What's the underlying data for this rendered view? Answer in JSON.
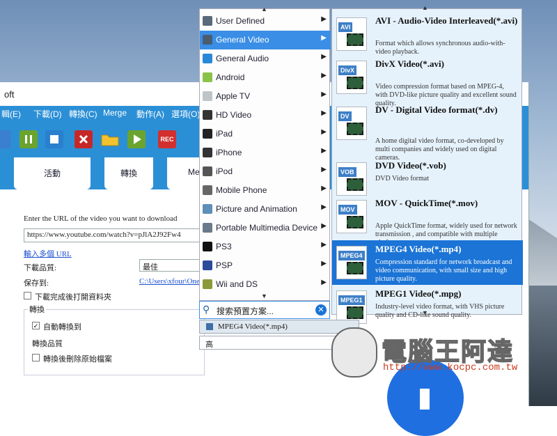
{
  "window": {
    "title_fragment": "oft"
  },
  "menu": [
    "輯(E)",
    "下載(D)",
    "轉換(C)",
    "Merge",
    "動作(A)",
    "選項(O)"
  ],
  "tabs": [
    "活動",
    "轉換",
    "Me"
  ],
  "form": {
    "url_prompt": "Enter the URL of the video you want to download",
    "url_value": "https://www.youtube.com/watch?v=pJlA2J92Fw4",
    "multi_url_link": "輸入多個 URL",
    "quality_label": "下載品質:",
    "quality_value": "最佳",
    "save_label": "保存到:",
    "save_path": "C:\\Users\\xfour\\OneD",
    "open_folder_label": "下載完成後打開資料夾",
    "convert_group_label": "轉換",
    "auto_convert_label": "自動轉換到",
    "convert_quality_label": "轉換品質",
    "delete_original_label": "轉換後刪除原始檔案"
  },
  "categories": [
    {
      "label": "User Defined",
      "icon": "user-icon",
      "color": "#5a6a7a"
    },
    {
      "label": "General Video",
      "icon": "film-icon",
      "color": "#4a5d70"
    },
    {
      "label": "General Audio",
      "icon": "music-note-icon",
      "color": "#2a88d8"
    },
    {
      "label": "Android",
      "icon": "android-icon",
      "color": "#8bc34a"
    },
    {
      "label": "Apple TV",
      "icon": "apple-tv-icon",
      "color": "#bfc4c8"
    },
    {
      "label": "HD Video",
      "icon": "hd-icon",
      "color": "#333333"
    },
    {
      "label": "iPad",
      "icon": "ipad-icon",
      "color": "#222222"
    },
    {
      "label": "iPhone",
      "icon": "iphone-icon",
      "color": "#333333"
    },
    {
      "label": "iPod",
      "icon": "ipod-icon",
      "color": "#555555"
    },
    {
      "label": "Mobile Phone",
      "icon": "mobile-phone-icon",
      "color": "#666666"
    },
    {
      "label": "Picture and Animation",
      "icon": "picture-icon",
      "color": "#5d8fb8"
    },
    {
      "label": "Portable Multimedia Device",
      "icon": "device-icon",
      "color": "#6a7a8a"
    },
    {
      "label": "PS3",
      "icon": "ps3-icon",
      "color": "#111111"
    },
    {
      "label": "PSP",
      "icon": "psp-icon",
      "color": "#2a4a9a"
    },
    {
      "label": "Wii and DS",
      "icon": "wii-icon",
      "color": "#8a9a3a"
    }
  ],
  "selected_category": "General Video",
  "formats": [
    {
      "badge": "AVI",
      "name": "AVI - Audio-Video Interleaved(*.avi)",
      "desc": "Format which allows synchronous audio-with-video playback."
    },
    {
      "badge": "DivX",
      "name": "DivX Video(*.avi)",
      "desc": "Video compression format based on MPEG-4, with DVD-like picture quality and excellent sound quality."
    },
    {
      "badge": "DV",
      "name": "DV - Digital Video format(*.dv)",
      "desc": "A home digital video format, co-developed by multi companies and widely used on digital cameras."
    },
    {
      "badge": "VOB",
      "name": "DVD Video(*.vob)",
      "desc": "DVD Video format"
    },
    {
      "badge": "MOV",
      "name": "MOV - QuickTime(*.mov)",
      "desc": "Apple QuickTime format, widely used for network transmission , and compatible with multiple platforms."
    },
    {
      "badge": "MPEG4",
      "name": "MPEG4 Video(*.mp4)",
      "desc": "Compression standard for network broadcast and video communication, with small size and high picture quality."
    },
    {
      "badge": "MPEG1",
      "name": "MPEG1 Video(*.mpg)",
      "desc": "Industry-level video format, with VHS picture quality and CD-like sound quality."
    }
  ],
  "selected_format": "MPEG4 Video(*.mp4)",
  "search": {
    "placeholder": "搜索預置方案..."
  },
  "current_format": "MPEG4 Video(*.mp4)",
  "convert_quality_value": "高",
  "watermark": {
    "text": "電腦王阿達",
    "url": "http://www.kocpc.com.tw"
  },
  "colors": {
    "accent": "#2b8fd6",
    "selected": "#1b74d6"
  }
}
